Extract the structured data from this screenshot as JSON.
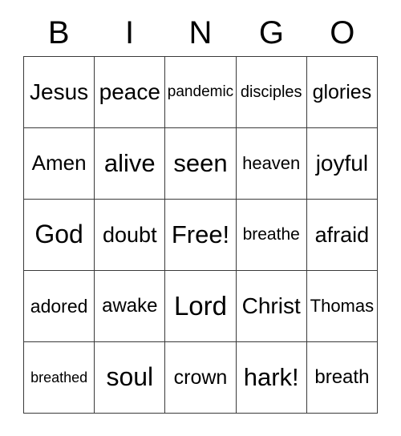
{
  "card": {
    "title": "BINGO",
    "header": [
      {
        "letter": "B"
      },
      {
        "letter": "I"
      },
      {
        "letter": "N"
      },
      {
        "letter": "G"
      },
      {
        "letter": "O"
      }
    ],
    "grid_size": "5x5",
    "free_space": "Free!",
    "rows": [
      [
        {
          "text": "Jesus",
          "font_px": 28
        },
        {
          "text": "peace",
          "font_px": 28
        },
        {
          "text": "pandemic",
          "font_px": 19
        },
        {
          "text": "disciples",
          "font_px": 20
        },
        {
          "text": "glories",
          "font_px": 25
        }
      ],
      [
        {
          "text": "Amen",
          "font_px": 26
        },
        {
          "text": "alive",
          "font_px": 31
        },
        {
          "text": "seen",
          "font_px": 31
        },
        {
          "text": "heaven",
          "font_px": 22
        },
        {
          "text": "joyful",
          "font_px": 28
        }
      ],
      [
        {
          "text": "God",
          "font_px": 32
        },
        {
          "text": "doubt",
          "font_px": 27
        },
        {
          "text": "Free!",
          "font_px": 31
        },
        {
          "text": "breathe",
          "font_px": 21
        },
        {
          "text": "afraid",
          "font_px": 27
        }
      ],
      [
        {
          "text": "adored",
          "font_px": 23
        },
        {
          "text": "awake",
          "font_px": 24
        },
        {
          "text": "Lord",
          "font_px": 33
        },
        {
          "text": "Christ",
          "font_px": 28
        },
        {
          "text": "Thomas",
          "font_px": 22
        }
      ],
      [
        {
          "text": "breathed",
          "font_px": 18
        },
        {
          "text": "soul",
          "font_px": 32
        },
        {
          "text": "crown",
          "font_px": 25
        },
        {
          "text": "hark!",
          "font_px": 31
        },
        {
          "text": "breath",
          "font_px": 24
        }
      ]
    ],
    "colors": {
      "background": "#ffffff",
      "text": "#000000",
      "grid_line": "#3a3a3a"
    }
  }
}
